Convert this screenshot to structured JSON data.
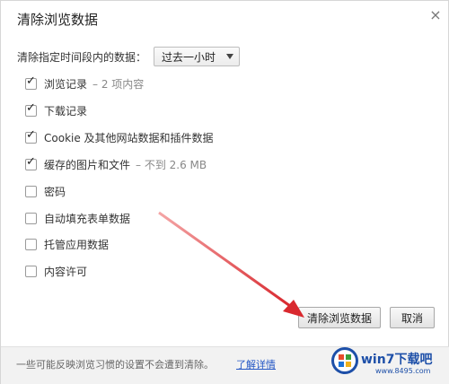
{
  "dialog": {
    "title": "清除浏览数据",
    "close_glyph": "×"
  },
  "range": {
    "label": "清除指定时间段内的数据：",
    "selected": "过去一小时"
  },
  "options": [
    {
      "label": "浏览记录",
      "meta": "– 2 项内容",
      "checked": true
    },
    {
      "label": "下载记录",
      "meta": "",
      "checked": true
    },
    {
      "label": "Cookie 及其他网站数据和插件数据",
      "meta": "",
      "checked": true
    },
    {
      "label": "缓存的图片和文件",
      "meta": "– 不到 2.6 MB",
      "checked": true
    },
    {
      "label": "密码",
      "meta": "",
      "checked": false
    },
    {
      "label": "自动填充表单数据",
      "meta": "",
      "checked": false
    },
    {
      "label": "托管应用数据",
      "meta": "",
      "checked": false
    },
    {
      "label": "内容许可",
      "meta": "",
      "checked": false
    }
  ],
  "buttons": {
    "clear_label": "清除浏览数据",
    "cancel_label": "取消"
  },
  "footer": {
    "text": "一些可能反映浏览习惯的设置不会遭到清除。",
    "link": "了解详情"
  },
  "watermark": {
    "text": "win7下载吧",
    "url": "www.8495.com"
  },
  "colors": {
    "arrow": "#d9282e",
    "link": "#2457c5",
    "watermark": "#1d4fa8"
  },
  "icons": {
    "checkbox_checked": "check-icon",
    "dropdown": "chevron-down-icon",
    "close": "close-icon",
    "watermark_logo": "win7-logo-icon"
  }
}
